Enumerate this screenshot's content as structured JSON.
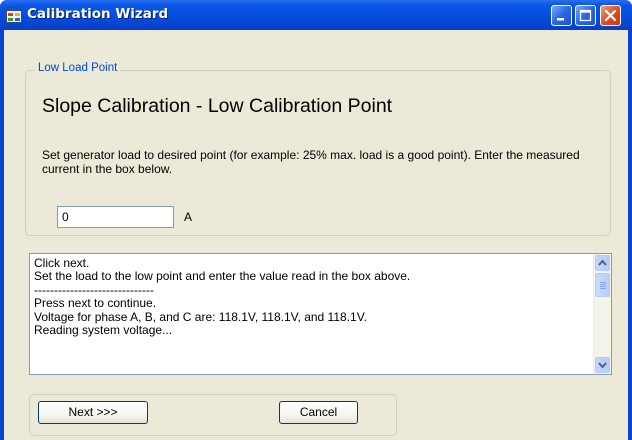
{
  "window": {
    "title": "Calibration Wizard",
    "icon": "app-window-icon",
    "controls": [
      "minimize-icon",
      "maximize-icon",
      "close-icon"
    ]
  },
  "group": {
    "legend": "Low Load Point",
    "heading": "Slope Calibration - Low Calibration Point",
    "instructions": "Set generator load to desired point (for example: 25% max. load is a good point).  Enter the measured current in the box below.",
    "current_value": "0",
    "unit": "A"
  },
  "log": {
    "lines": [
      "Click next.",
      "Set the load to the low point and enter the value read in the box above.",
      "------------------------------",
      "Press next to continue.",
      "Voltage for phase A, B, and C are: 118.1V, 118.1V, and 118.1V.",
      "Reading system voltage..."
    ]
  },
  "buttons": {
    "next": "Next >>>",
    "cancel": "Cancel"
  },
  "colors": {
    "titlebar": "#0650e0",
    "client_bg": "#ece9d8",
    "legend_text": "#0046d5",
    "close_button": "#e05028"
  }
}
